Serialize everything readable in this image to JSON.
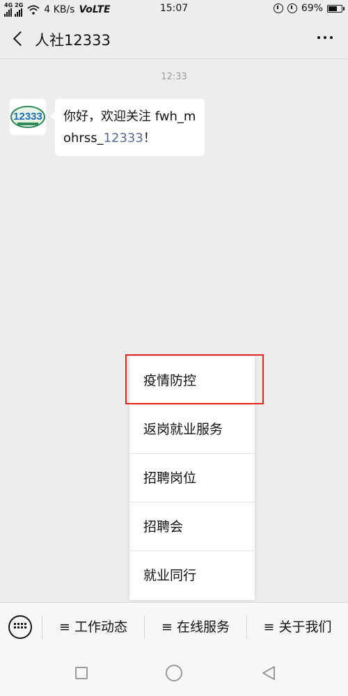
{
  "status_bar": {
    "network_speed": "4 KB/s",
    "volte": "VoLTE",
    "time": "15:07",
    "battery": "69%",
    "battery_level": 0.69,
    "sig1": "4G",
    "sig2": "2G"
  },
  "header": {
    "title": "人社12333"
  },
  "chat": {
    "timestamp": "12:33",
    "avatar_text": "12333",
    "message_prefix": "你好，欢迎关注 fwh_mohrss_",
    "message_link": "12333",
    "message_suffix": "！"
  },
  "popup_menu": {
    "items": [
      {
        "label": "疫情防控",
        "highlighted": true
      },
      {
        "label": "返岗就业服务"
      },
      {
        "label": "招聘岗位"
      },
      {
        "label": "招聘会"
      },
      {
        "label": "就业同行"
      }
    ]
  },
  "bottom_menu": {
    "items": [
      {
        "label": "≡ 工作动态"
      },
      {
        "label": "≡ 在线服务"
      },
      {
        "label": "≡ 关于我们"
      }
    ]
  },
  "colors": {
    "link": "#576b95",
    "highlight_border": "#e8231e",
    "background": "#ededed"
  }
}
